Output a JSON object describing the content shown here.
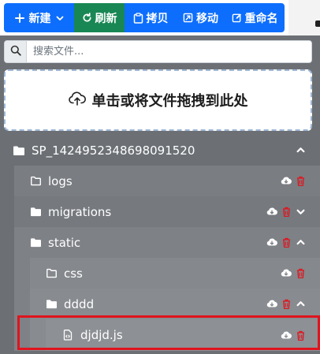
{
  "toolbar": {
    "new_label": "新建",
    "refresh_label": "刷新",
    "copy_label": "拷贝",
    "move_label": "移动",
    "rename_label": "重命名"
  },
  "search": {
    "placeholder": "搜索文件..."
  },
  "dropzone": {
    "label": "单击或将文件拖拽到此处"
  },
  "tree": {
    "root": "SP_1424952348698091520",
    "items": [
      {
        "name": "logs"
      },
      {
        "name": "migrations"
      },
      {
        "name": "static"
      },
      {
        "name": "css"
      },
      {
        "name": "dddd"
      },
      {
        "name": "djdjd.js"
      }
    ]
  },
  "colors": {
    "primary": "#0d6efd",
    "success": "#198754",
    "delete": "#e0141e",
    "highlight": "#e0141e"
  }
}
